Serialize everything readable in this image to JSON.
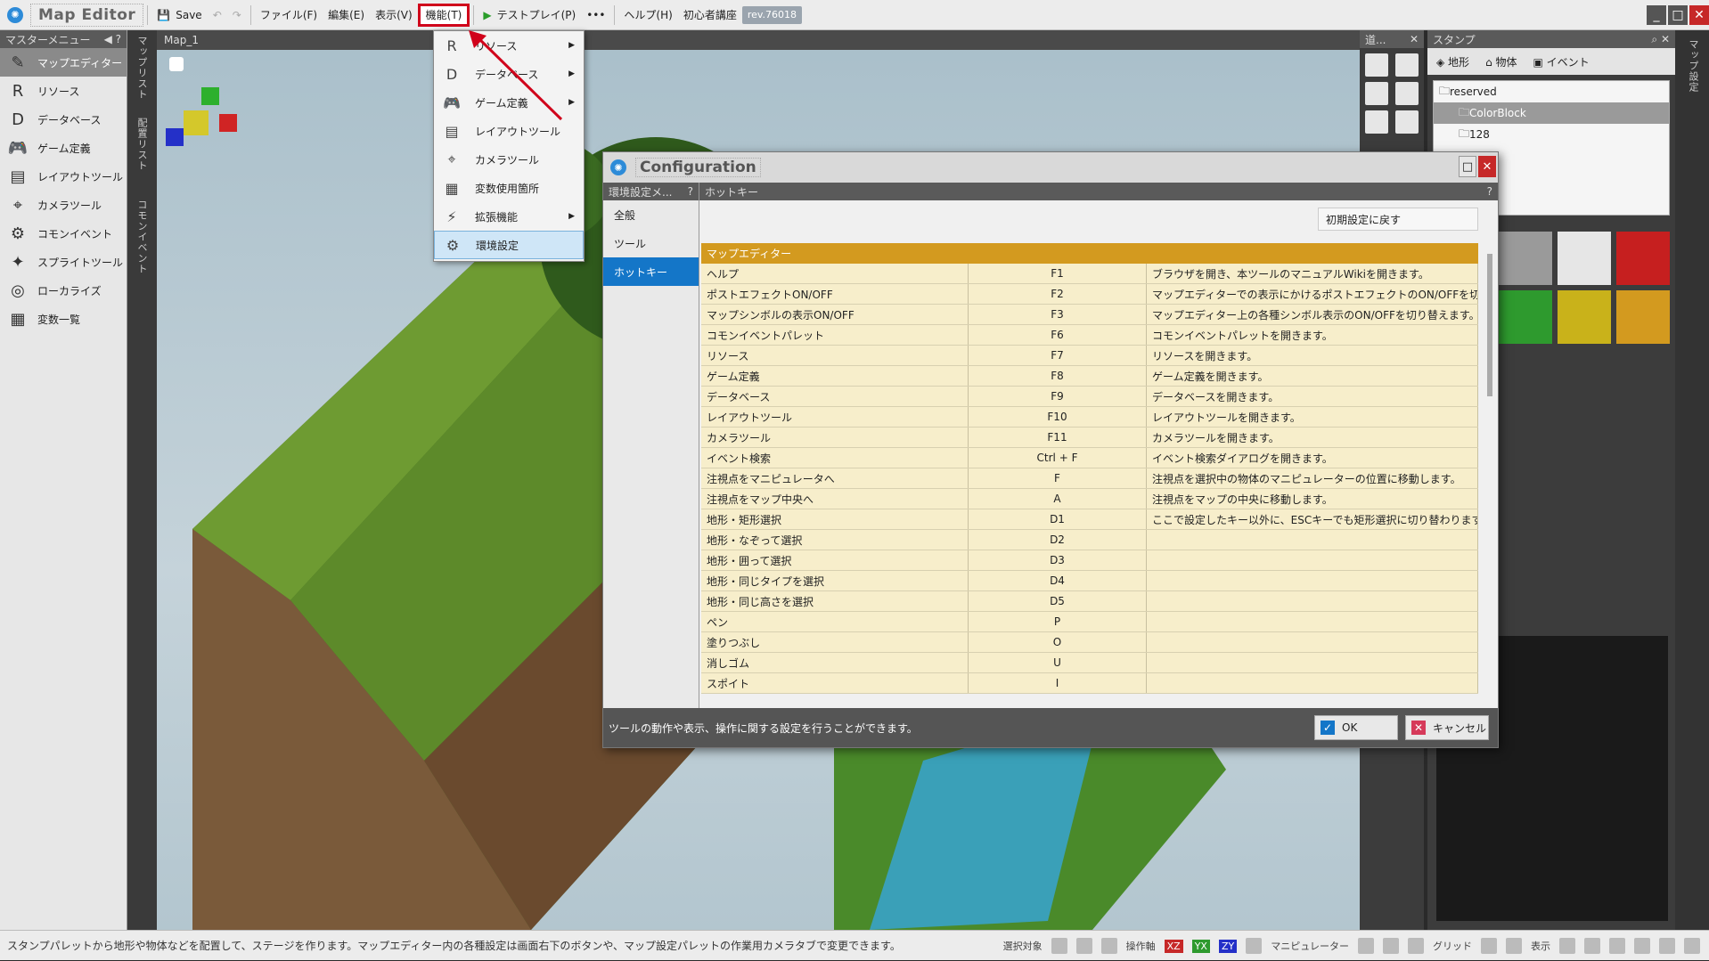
{
  "toolbar": {
    "app_title": "Map Editor",
    "save_label": "Save",
    "menus": [
      "ファイル(F)",
      "編集(E)",
      "表示(V)",
      "機能(T)"
    ],
    "test_play": "テストプレイ(P)",
    "more": "•••",
    "help": "ヘルプ(H)",
    "beginner": "初心者講座",
    "rev": "rev.76018"
  },
  "master": {
    "title": "マスターメニュー",
    "items": [
      "マップエディター",
      "リソース",
      "データベース",
      "ゲーム定義",
      "レイアウトツール",
      "カメラツール",
      "コモンイベント",
      "スプライトツール",
      "ローカライズ",
      "変数一覧"
    ]
  },
  "vtabs": [
    "マップリスト",
    "配置リスト",
    "コモンイベント"
  ],
  "viewport": {
    "tab": "Map_1"
  },
  "dropdown": {
    "items": [
      {
        "label": "リソース",
        "sub": true
      },
      {
        "label": "データベース",
        "sub": true
      },
      {
        "label": "ゲーム定義",
        "sub": true
      },
      {
        "label": "レイアウトツール",
        "sub": false
      },
      {
        "label": "カメラツール",
        "sub": false
      },
      {
        "label": "変数使用箇所",
        "sub": false
      },
      {
        "label": "拡張機能",
        "sub": true
      },
      {
        "label": "環境設定",
        "sub": false
      }
    ]
  },
  "dialog": {
    "title": "Configuration",
    "left_header": "環境設定メ...",
    "left_items": [
      "全般",
      "ツール",
      "ホットキー"
    ],
    "right_header": "ホットキー",
    "reset": "初期設定に戻す",
    "group": "マップエディター",
    "rows": [
      [
        "ヘルプ",
        "F1",
        "ブラウザを開き、本ツールのマニュアルWikiを開きます。"
      ],
      [
        "ポストエフェクトON/OFF",
        "F2",
        "マップエディターでの表示にかけるポストエフェクトのON/OFFを切り替..."
      ],
      [
        "マップシンボルの表示ON/OFF",
        "F3",
        "マップエディター上の各種シンボル表示のON/OFFを切り替えます。"
      ],
      [
        "コモンイベントパレット",
        "F6",
        "コモンイベントパレットを開きます。"
      ],
      [
        "リソース",
        "F7",
        "リソースを開きます。"
      ],
      [
        "ゲーム定義",
        "F8",
        "ゲーム定義を開きます。"
      ],
      [
        "データベース",
        "F9",
        "データベースを開きます。"
      ],
      [
        "レイアウトツール",
        "F10",
        "レイアウトツールを開きます。"
      ],
      [
        "カメラツール",
        "F11",
        "カメラツールを開きます。"
      ],
      [
        "イベント検索",
        "Ctrl + F",
        "イベント検索ダイアログを開きます。"
      ],
      [
        "注視点をマニピュレータへ",
        "F",
        "注視点を選択中の物体のマニピュレーターの位置に移動します。"
      ],
      [
        "注視点をマップ中央へ",
        "A",
        "注視点をマップの中央に移動します。"
      ],
      [
        "地形・矩形選択",
        "D1",
        "ここで設定したキー以外に、ESCキーでも矩形選択に切り替わります。"
      ],
      [
        "地形・なぞって選択",
        "D2",
        ""
      ],
      [
        "地形・囲って選択",
        "D3",
        ""
      ],
      [
        "地形・同じタイプを選択",
        "D4",
        ""
      ],
      [
        "地形・同じ高さを選択",
        "D5",
        ""
      ],
      [
        "ペン",
        "P",
        ""
      ],
      [
        "塗りつぶし",
        "O",
        ""
      ],
      [
        "消しゴム",
        "U",
        ""
      ],
      [
        "スポイト",
        "I",
        ""
      ]
    ],
    "footer": "ツールの動作や表示、操作に関する設定を行うことができます。",
    "ok": "OK",
    "cancel": "キャンセル"
  },
  "rpanel1": {
    "title": "道..."
  },
  "stamp": {
    "title": "スタンプ",
    "tabs": [
      "地形",
      "物体",
      "イベント"
    ],
    "tree": [
      "reserved",
      "ColorBlock",
      "128"
    ]
  },
  "rstrip": {
    "label": "マップ設定"
  },
  "status": {
    "message": "スタンプパレットから地形や物体などを配置して、ステージを作ります。マップエディター内の各種設定は画面右下のボタンや、マップ設定パレットの作業用カメラタブで変更できます。",
    "labels": [
      "選択対象",
      "操作軸",
      "XZ",
      "YX",
      "ZY",
      "マニピュレーター",
      "グリッド",
      "表示"
    ]
  },
  "colors": {
    "accent": "#d0021b",
    "selection": "#1476c8",
    "group": "#d39a1f",
    "row": "#f7eecb"
  }
}
